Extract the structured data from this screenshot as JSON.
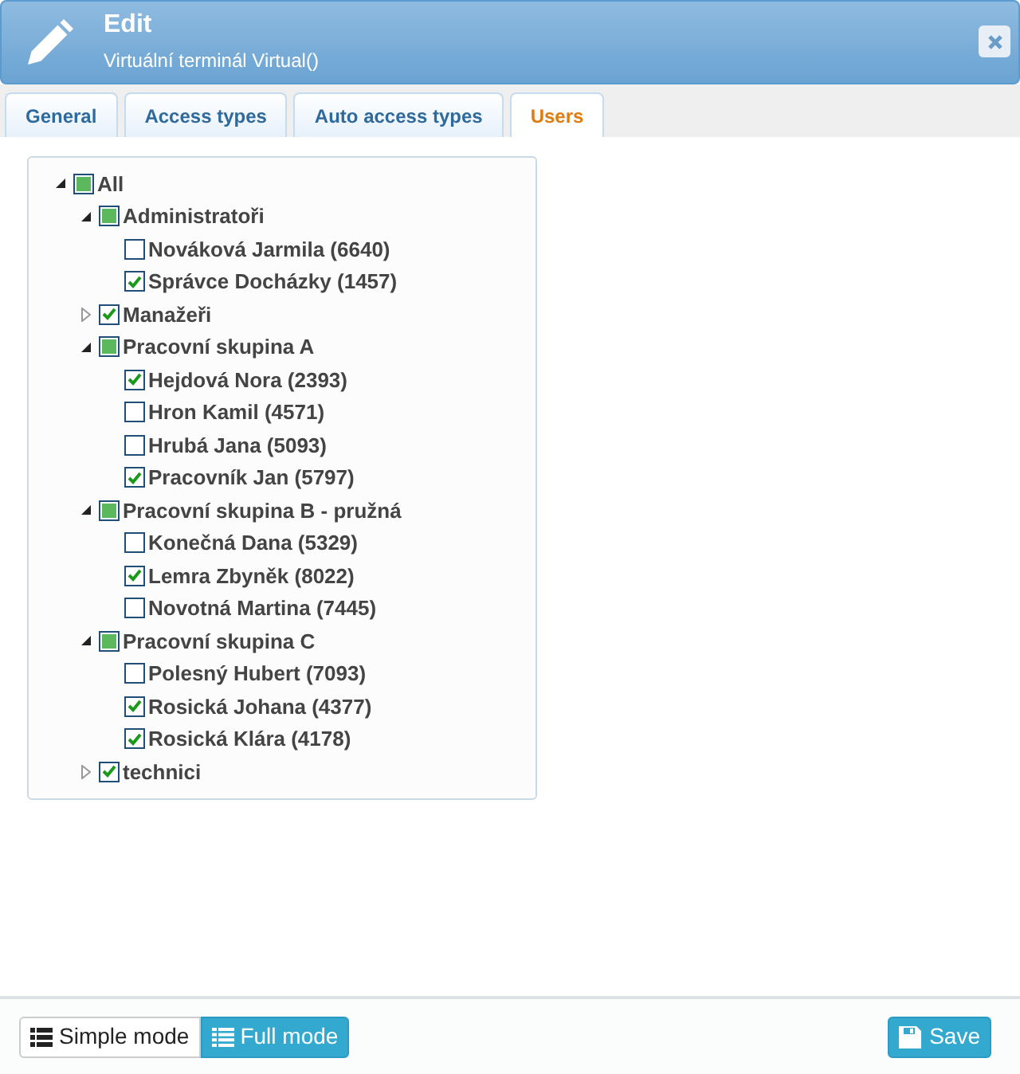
{
  "header": {
    "title": "Edit",
    "subtitle": "Virtuální terminál Virtual()"
  },
  "tabs": [
    {
      "label": "General",
      "selected": false
    },
    {
      "label": "Access types",
      "selected": false
    },
    {
      "label": "Auto access types",
      "selected": false
    },
    {
      "label": "Users",
      "selected": true
    }
  ],
  "tree": [
    {
      "label": "All",
      "checked": false,
      "partial": true,
      "expanded": true,
      "children": [
        {
          "label": "Administratoři",
          "checked": false,
          "partial": true,
          "expanded": true,
          "children": [
            {
              "label": "Nováková Jarmila (6640)",
              "checked": false,
              "partial": false
            },
            {
              "label": "Správce Docházky (1457)",
              "checked": true,
              "partial": false
            }
          ]
        },
        {
          "label": "Manažeři",
          "checked": true,
          "partial": false,
          "expanded": false
        },
        {
          "label": "Pracovní skupina A",
          "checked": false,
          "partial": true,
          "expanded": true,
          "children": [
            {
              "label": "Hejdová Nora (2393)",
              "checked": true,
              "partial": false
            },
            {
              "label": "Hron Kamil (4571)",
              "checked": false,
              "partial": false
            },
            {
              "label": "Hrubá Jana (5093)",
              "checked": false,
              "partial": false
            },
            {
              "label": "Pracovník Jan (5797)",
              "checked": true,
              "partial": false
            }
          ]
        },
        {
          "label": "Pracovní skupina B - pružná",
          "checked": false,
          "partial": true,
          "expanded": true,
          "children": [
            {
              "label": "Konečná Dana (5329)",
              "checked": false,
              "partial": false
            },
            {
              "label": "Lemra Zbyněk (8022)",
              "checked": true,
              "partial": false
            },
            {
              "label": "Novotná Martina (7445)",
              "checked": false,
              "partial": false
            }
          ]
        },
        {
          "label": "Pracovní skupina C",
          "checked": false,
          "partial": true,
          "expanded": true,
          "children": [
            {
              "label": "Polesný Hubert (7093)",
              "checked": false,
              "partial": false
            },
            {
              "label": "Rosická Johana (4377)",
              "checked": true,
              "partial": false
            },
            {
              "label": "Rosická Klára (4178)",
              "checked": true,
              "partial": false
            }
          ]
        },
        {
          "label": "technici",
          "checked": true,
          "partial": false,
          "expanded": false
        }
      ]
    }
  ],
  "mode_buttons": [
    {
      "label": "Simple mode",
      "selected": false
    },
    {
      "label": "Full mode",
      "selected": true
    }
  ],
  "save_button": {
    "label": "Save"
  }
}
